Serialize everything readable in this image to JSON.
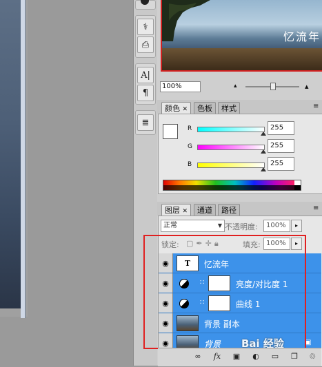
{
  "navigator": {
    "overlay_text": "忆流年",
    "zoom_value": "100%"
  },
  "color_panel": {
    "tabs": [
      {
        "label": "颜色",
        "active": true,
        "closable": true
      },
      {
        "label": "色板",
        "active": false
      },
      {
        "label": "样式",
        "active": false
      }
    ],
    "channels": [
      {
        "name": "R",
        "value": "255",
        "color": "#00ffff"
      },
      {
        "name": "G",
        "value": "255",
        "color": "#ff00ff"
      },
      {
        "name": "B",
        "value": "255",
        "color": "#ffff00"
      }
    ]
  },
  "layers_panel": {
    "tabs": [
      {
        "label": "图层",
        "active": true,
        "closable": true
      },
      {
        "label": "通道",
        "active": false
      },
      {
        "label": "路径",
        "active": false
      }
    ],
    "blend_mode": "正常",
    "opacity_label": "不透明度:",
    "opacity_value": "100%",
    "lock_label": "锁定:",
    "fill_label": "填充:",
    "fill_value": "100%",
    "layers": [
      {
        "name": "忆流年",
        "type": "text",
        "thumb_text": "T"
      },
      {
        "name": "亮度/对比度 1",
        "type": "adjustment"
      },
      {
        "name": "曲线 1",
        "type": "adjustment"
      },
      {
        "name": "背景 副本",
        "type": "image"
      },
      {
        "name": "背景",
        "type": "image",
        "locked": true
      }
    ],
    "footer_fx": "fx"
  },
  "watermark": "Bai 经验",
  "colors": {
    "selection_blue": "#3d92ea",
    "highlight_red": "#e02020",
    "panel_gray": "#e7e7e7"
  }
}
